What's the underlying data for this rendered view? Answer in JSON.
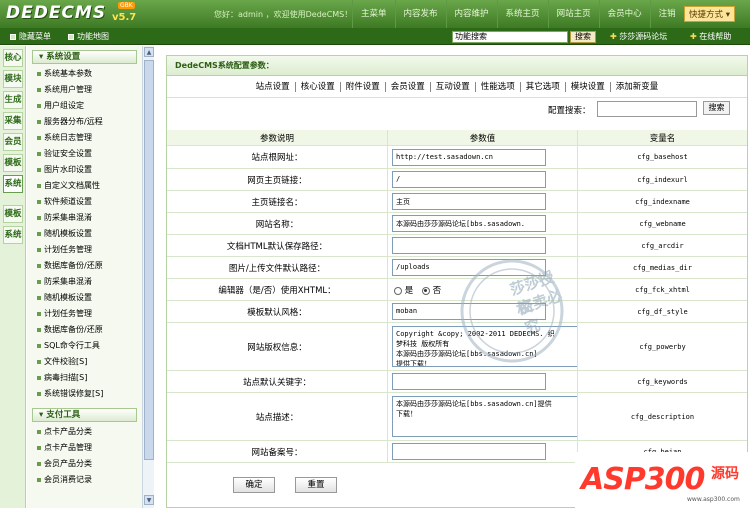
{
  "header": {
    "logo": "DEDECMS",
    "version": "v5.7",
    "badge": "GBK",
    "welcome": "您好：admin ，欢迎使用DedeCMS！",
    "nav": [
      "主菜单",
      "内容发布",
      "内容维护",
      "系统主页",
      "网站主页",
      "会员中心",
      "注销"
    ],
    "quick_button": "快捷方式 ▾"
  },
  "subbar": {
    "hide_menu": "隐藏菜单",
    "site_map": "功能地图",
    "search_value": "功能搜索",
    "search_button": "搜索",
    "forum_link": "莎莎源码论坛",
    "help_link": "在线帮助"
  },
  "vtabs": [
    "核心",
    "模块",
    "生成",
    "采集",
    "会员",
    "模板",
    "系统",
    "模板",
    "系统"
  ],
  "menu": {
    "group1": "系统设置",
    "items1": [
      "系统基本参数",
      "系统用户管理",
      "用户组设定",
      "服务器分布/远程",
      "系统日志管理",
      "验证安全设置",
      "图片水印设置",
      "自定义文档属性",
      "软件频道设置",
      "防采集串混淆",
      "随机模板设置",
      "计划任务管理",
      "数据库备份/还原",
      "防采集串混淆",
      "随机模板设置",
      "计划任务管理",
      "数据库备份/还原",
      "SQL命令行工具",
      "文件校验[S]",
      "病毒扫描[S]",
      "系统错误修复[S]"
    ],
    "group2": "支付工具",
    "items2": [
      "点卡产品分类",
      "点卡产品管理",
      "会员产品分类",
      "会员消费记录"
    ]
  },
  "page": {
    "title": "DedeCMS系统配置参数：",
    "tabs": [
      "站点设置",
      "核心设置",
      "附件设置",
      "会员设置",
      "互动设置",
      "性能选项",
      "其它选项",
      "模块设置",
      "添加新变量"
    ],
    "search_label": "配置搜索：",
    "search_button": "搜索",
    "col_desc": "参数说明",
    "col_value": "参数值",
    "col_var": "变量名",
    "rows": [
      {
        "label": "站点根网址：",
        "value": "http://test.sasadown.cn",
        "var": "cfg_basehost"
      },
      {
        "label": "网页主页链接：",
        "value": "/",
        "var": "cfg_indexurl"
      },
      {
        "label": "主页链接名：",
        "value": "主页",
        "var": "cfg_indexname"
      },
      {
        "label": "网站名称：",
        "value": "本源码由莎莎源码论坛[bbs.sasadown.",
        "var": "cfg_webname"
      },
      {
        "label": "文档HTML默认保存路径：",
        "value": "",
        "var": "cfg_arcdir"
      },
      {
        "label": "图片/上传文件默认路径：",
        "value": "/uploads",
        "var": "cfg_medias_dir"
      },
      {
        "label": "编辑器（是/否）使用XHTML：",
        "value": "",
        "var": "cfg_fck_xhtml"
      },
      {
        "label": "模板默认风格：",
        "value": "moban",
        "var": "cfg_df_style"
      },
      {
        "label": "网站版权信息：",
        "value": "",
        "var": "cfg_powerby"
      },
      {
        "label": "站点默认关键字：",
        "value": "",
        "var": "cfg_keywords"
      },
      {
        "label": "站点描述：",
        "value": "",
        "var": "cfg_description"
      },
      {
        "label": "网站备案号：",
        "value": "",
        "var": "cfg_beian"
      }
    ],
    "radio_yes": "是",
    "radio_no": "否",
    "copyright_lines": [
      "Copyright &copy; 2002-2011 DEDECMS. 织",
      "梦科技 版权所有",
      "本源码由莎莎源码论坛[bbs.sasadown.cn]",
      "提供下载！"
    ],
    "description_lines": [
      "本源码由莎莎源码论坛[bbs.sasadown.cn]提供",
      "下载！"
    ],
    "ok_button": "确定",
    "reset_button": "重置"
  },
  "watermark": {
    "line1": "莎莎授权",
    "line2": "盗卖必究"
  },
  "brand": {
    "main": "ASP300",
    "cn": "源码",
    "url": "www.asp300.com"
  }
}
